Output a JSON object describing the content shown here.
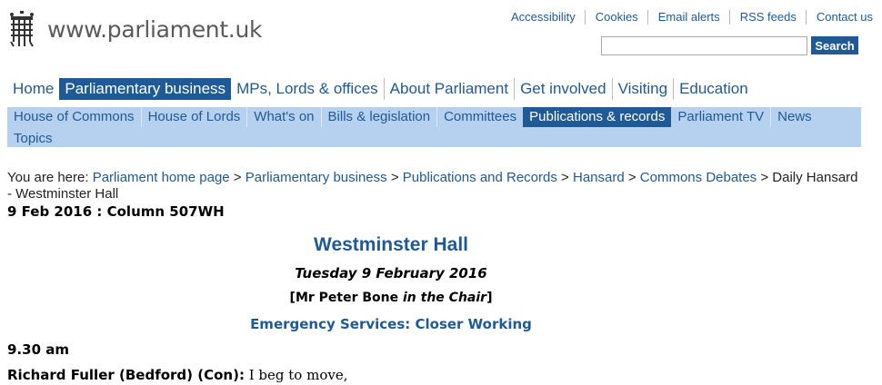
{
  "logo": {
    "text": "www.parliament.uk",
    "icon": "portcullis-icon"
  },
  "utility_links": [
    "Accessibility",
    "Cookies",
    "Email alerts",
    "RSS feeds",
    "Contact us"
  ],
  "search": {
    "placeholder": "",
    "value": "",
    "button_label": "Search"
  },
  "main_nav": {
    "items": [
      "Home",
      "Parliamentary business",
      "MPs, Lords & offices",
      "About Parliament",
      "Get involved",
      "Visiting",
      "Education"
    ],
    "active": "Parliamentary business"
  },
  "sub_nav": {
    "row1": [
      "House of Commons",
      "House of Lords",
      "What's on",
      "Bills & legislation",
      "Committees",
      "Publications & records",
      "Parliament TV",
      "News"
    ],
    "row2": [
      "Topics"
    ],
    "active": "Publications & records"
  },
  "breadcrumb": {
    "prefix": "You are here:",
    "links": [
      "Parliament home page",
      "Parliamentary business",
      "Publications and Records",
      "Hansard",
      "Commons Debates"
    ],
    "current": "Daily Hansard - Westminster Hall"
  },
  "column_ref": "9 Feb 2016 : Column 507WH",
  "content": {
    "title": "Westminster Hall",
    "date": "Tuesday 9 February 2016",
    "chair_open": "[",
    "chair_name": "Mr Peter Bone",
    "chair_role": "in the Chair",
    "chair_close": "]",
    "debate_title": "Emergency Services: Closer Working",
    "time": "9.30 am",
    "speaker": "Richard Fuller (Bedford) (Con):",
    "speech": "I beg to move,"
  },
  "colors": {
    "brand_blue": "#1f5a96",
    "subnav_bg": "#b6d1ef"
  }
}
